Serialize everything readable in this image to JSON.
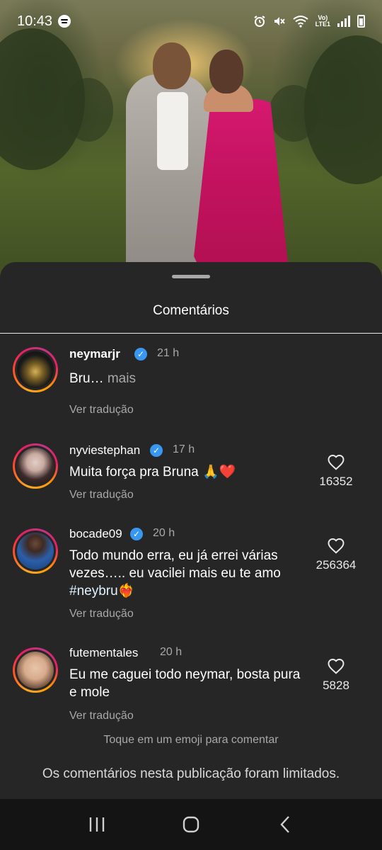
{
  "status_bar": {
    "time": "10:43",
    "lte_top": "Vo)",
    "lte_bottom": "LTE1"
  },
  "sheet": {
    "title": "Comentários"
  },
  "comments": [
    {
      "username": "neymarjr",
      "verified": true,
      "time": "21 h",
      "text": "Bru…",
      "more": " mais",
      "translate": "Ver tradução"
    },
    {
      "username": "nyviestephan",
      "verified": true,
      "time": "17 h",
      "text": "Muita força pra Bruna 🙏❤️",
      "translate": "Ver tradução",
      "likes": "16352"
    },
    {
      "username": "bocade09",
      "verified": true,
      "time": "20 h",
      "text": "Todo mundo erra, eu já errei várias vezes….. eu vacilei mais eu te amo ",
      "hashtag": "#neybru❤️‍🔥",
      "translate": "Ver tradução",
      "likes": "256364"
    },
    {
      "username": "futementales",
      "verified": false,
      "time": "20 h",
      "text": "Eu me caguei todo neymar, bosta pura e mole",
      "translate": "Ver tradução",
      "likes": "5828"
    }
  ],
  "emoji_hint": "Toque em um emoji para comentar",
  "limited_note": "Os comentários nesta publicação foram limitados.",
  "colors": {
    "sheet_bg": "#262626",
    "verified": "#3897f0",
    "muted_text": "#a8a8a8"
  }
}
